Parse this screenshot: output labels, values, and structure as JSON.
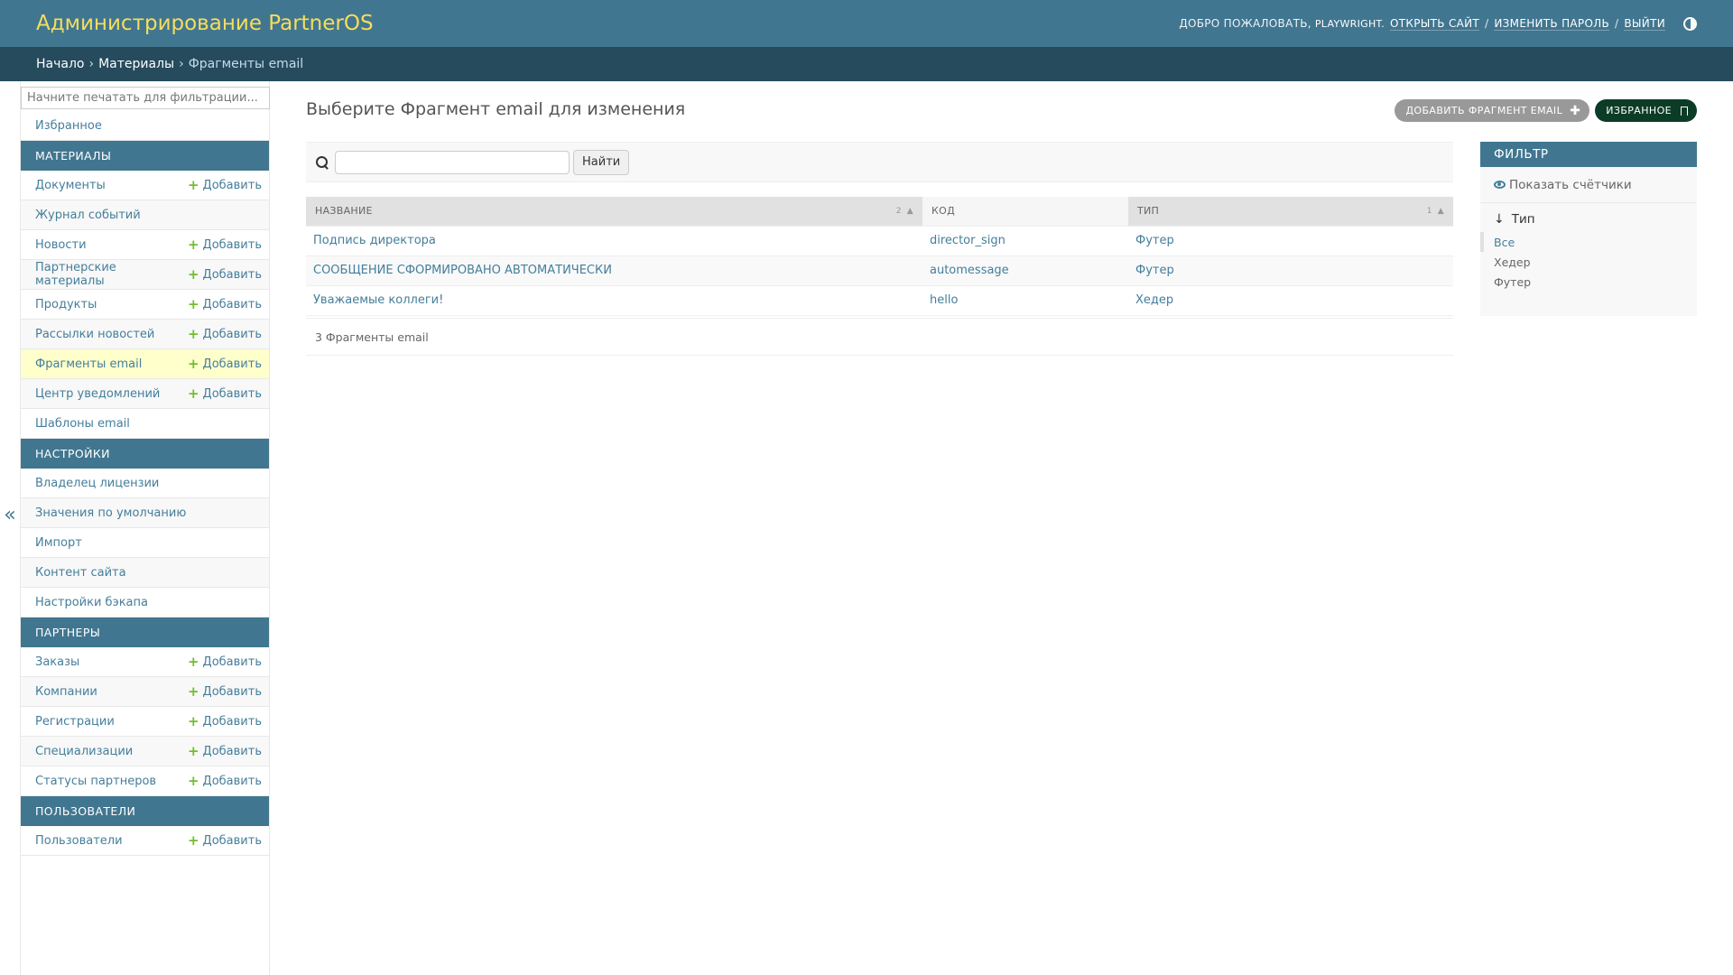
{
  "header": {
    "branding": "Администрирование PartnerOS",
    "welcome": "Добро пожаловать,",
    "username": "playwright.",
    "links": [
      "Открыть сайт",
      "Изменить пароль",
      "Выйти"
    ],
    "separator": "/"
  },
  "breadcrumbs": {
    "home": "Начало",
    "app": "Материалы",
    "current": "Фрагменты email",
    "separator": "›"
  },
  "sidebar": {
    "toggle": "«",
    "filter_placeholder": "Начните печатать для фильтрации...",
    "favorites": "Избранное",
    "add_label": "Добавить",
    "sections": [
      {
        "title": "Материалы",
        "items": [
          {
            "label": "Документы",
            "add": true
          },
          {
            "label": "Журнал событий",
            "add": false
          },
          {
            "label": "Новости",
            "add": true
          },
          {
            "label": "Партнерские материалы",
            "add": true
          },
          {
            "label": "Продукты",
            "add": true
          },
          {
            "label": "Рассылки новостей",
            "add": true
          },
          {
            "label": "Фрагменты email",
            "add": true,
            "current": true
          },
          {
            "label": "Центр уведомлений",
            "add": true
          },
          {
            "label": "Шаблоны email",
            "add": false
          }
        ]
      },
      {
        "title": "Настройки",
        "items": [
          {
            "label": "Владелец лицензии",
            "add": false
          },
          {
            "label": "Значения по умолчанию",
            "add": false
          },
          {
            "label": "Импорт",
            "add": false
          },
          {
            "label": "Контент сайта",
            "add": false
          },
          {
            "label": "Настройки бэкапа",
            "add": false
          }
        ]
      },
      {
        "title": "Партнеры",
        "items": [
          {
            "label": "Заказы",
            "add": true
          },
          {
            "label": "Компании",
            "add": true
          },
          {
            "label": "Регистрации",
            "add": true
          },
          {
            "label": "Специализации",
            "add": true
          },
          {
            "label": "Статусы партнеров",
            "add": true
          }
        ]
      },
      {
        "title": "Пользователи",
        "items": [
          {
            "label": "Пользователи",
            "add": true
          }
        ]
      }
    ]
  },
  "content": {
    "title": "Выберите Фрагмент email для изменения",
    "add_button": "Добавить Фрагмент email",
    "favorites_button": "Избранное",
    "search_button": "Найти",
    "search_value": "",
    "columns": [
      {
        "label": "Название",
        "sort_priority": "2"
      },
      {
        "label": "Код",
        "sort_priority": ""
      },
      {
        "label": "Тип",
        "sort_priority": "1"
      }
    ],
    "rows": [
      {
        "name": "Подпись директора",
        "code": "director_sign",
        "type": "Футер"
      },
      {
        "name": "СООБЩЕНИЕ СФОРМИРОВАНО АВТОМАТИЧЕСКИ",
        "code": "automessage",
        "type": "Футер"
      },
      {
        "name": "Уважаемые коллеги!",
        "code": "hello",
        "type": "Хедер"
      }
    ],
    "result_count": "3 Фрагменты email"
  },
  "filter": {
    "title": "Фильтр",
    "show_counts": "Показать счётчики",
    "field_title": "Тип",
    "field_arrow": "↓",
    "choices": [
      {
        "label": "Все",
        "selected": true
      },
      {
        "label": "Хедер",
        "selected": false
      },
      {
        "label": "Футер",
        "selected": false
      }
    ]
  },
  "colors": {
    "header_bg": "#417690",
    "branding": "#f5dd5d",
    "breadcrumbs_bg": "#264b5d",
    "link": "#447e9b",
    "add_plus": "#70bf2b",
    "current_row": "#ffffcc",
    "favorites_btn": "#0c3c26"
  }
}
